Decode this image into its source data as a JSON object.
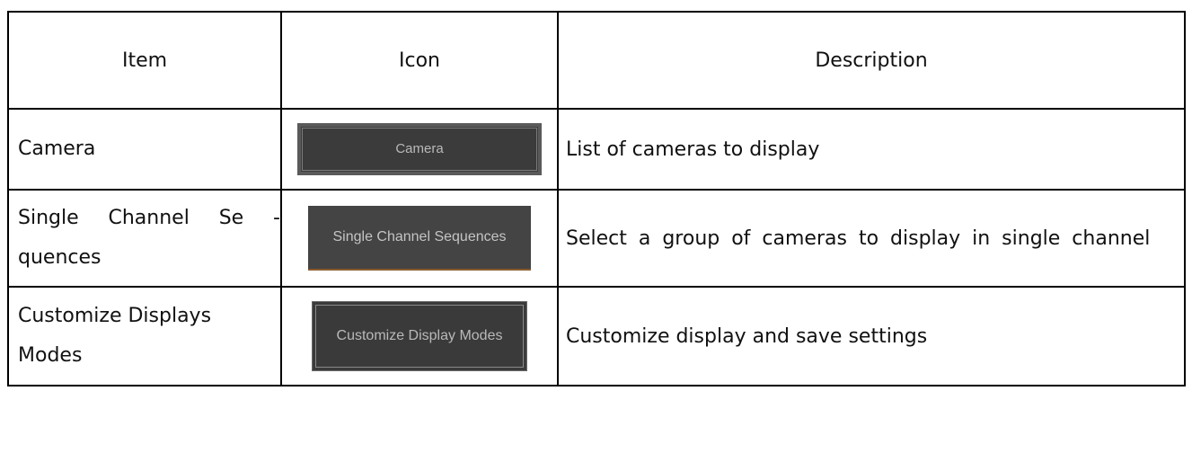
{
  "headers": {
    "item": "Item",
    "icon": "Icon",
    "description": "Description"
  },
  "rows": [
    {
      "item_line1": "Camera",
      "item_line2": "",
      "icon_label": "Camera",
      "description": "List of cameras to display"
    },
    {
      "item_line1": "Single Channel Se -",
      "item_line2": "quences",
      "icon_label": "Single Channel Sequences",
      "description": "Select a group of cameras to display in single channel"
    },
    {
      "item_line1": "Customize Displays",
      "item_line2": "Modes",
      "icon_label": "Customize Display Modes",
      "description": "Customize display and save settings"
    }
  ]
}
